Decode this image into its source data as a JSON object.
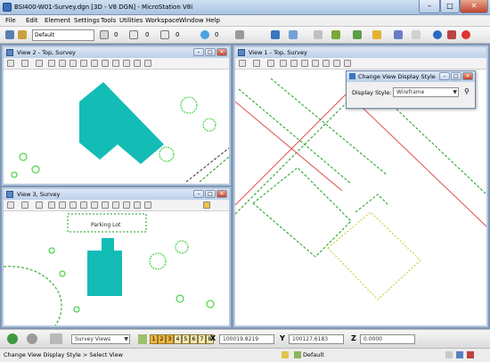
{
  "window": {
    "title": "BSI400-W01-Survey.dgn [3D - V8 DGN] - MicroStation V8i"
  },
  "menu": [
    "File",
    "Edit",
    "Element",
    "Settings",
    "Tools",
    "Utilities",
    "Workspace",
    "Window",
    "Help"
  ],
  "toolbar": {
    "level": "Default",
    "weight_values": [
      "0",
      "0",
      "0",
      "0"
    ]
  },
  "views": {
    "view1": {
      "title": "View 1 - Top, Survey"
    },
    "view2": {
      "title": "View 2 - Top, Survey"
    },
    "view3": {
      "title": "View 3, Survey",
      "parking_label": "Parking Lot"
    }
  },
  "dialog": {
    "title": "Change View Display Style",
    "label": "Display Style:",
    "value": "Wireframe"
  },
  "status": {
    "saved_view": "Survey Views",
    "view_numbers": [
      "1",
      "2",
      "3",
      "4",
      "5",
      "6",
      "7",
      "8"
    ],
    "active_views": [
      "1",
      "2",
      "3"
    ],
    "x_label": "X",
    "x_value": "100019.8219",
    "y_label": "Y",
    "y_value": "100127.6183",
    "z_label": "Z",
    "z_value": "0.0000"
  },
  "bottom": {
    "prompt": "Change View Display Style > Select View",
    "level": "Default"
  },
  "colors": {
    "building": "#13bdb6",
    "tree": "#22cc22",
    "dashed": "#1a9e1a",
    "road_red": "#e05050",
    "yellow": "#c8c82a"
  }
}
